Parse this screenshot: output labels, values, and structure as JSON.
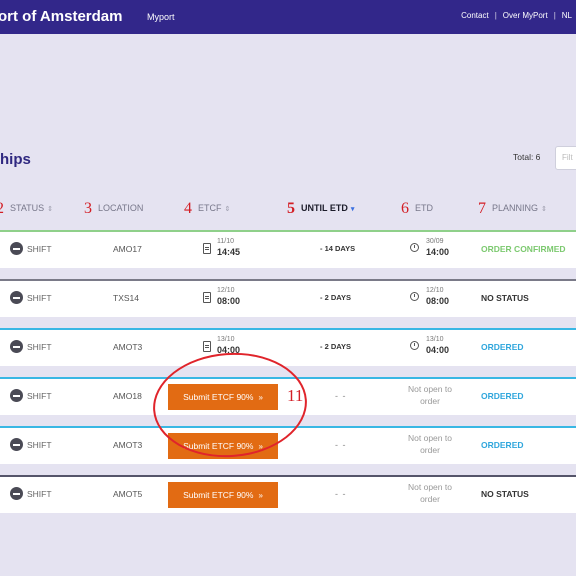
{
  "header": {
    "brand": "ort of Amsterdam",
    "myport": "Myport",
    "nav": [
      "Contact",
      "|",
      "Over MyPort",
      "|",
      "NL"
    ]
  },
  "page": {
    "title": "hips",
    "total_label": "Total: 6",
    "filter_placeholder": "Filt"
  },
  "columns": [
    {
      "num": "2",
      "label": "STATUS",
      "arrow": "⇕"
    },
    {
      "num": "3",
      "label": "LOCATION",
      "arrow": ""
    },
    {
      "num": "4",
      "label": "ETCF",
      "arrow": "⇕"
    },
    {
      "num": "5",
      "label": "UNTIL ETD",
      "arrow": "▾"
    },
    {
      "num": "6",
      "label": "ETD",
      "arrow": ""
    },
    {
      "num": "7",
      "label": "PLANNING",
      "arrow": "⇕"
    }
  ],
  "rows": [
    {
      "status": "SHIFT",
      "location": "AMO17",
      "etcf_date": "11/10",
      "etcf_time": "14:45",
      "until": "- 14 DAYS",
      "etd_date": "30/09",
      "etd_time": "14:00",
      "planning": "ORDER CONFIRMED"
    },
    {
      "status": "SHIFT",
      "location": "TXS14",
      "etcf_date": "12/10",
      "etcf_time": "08:00",
      "until": "- 2 DAYS",
      "etd_date": "12/10",
      "etd_time": "08:00",
      "planning": "NO STATUS"
    },
    {
      "status": "SHIFT",
      "location": "AMOT3",
      "etcf_date": "13/10",
      "etcf_time": "04:00",
      "until": "- 2 DAYS",
      "etd_date": "13/10",
      "etd_time": "04:00",
      "planning": "ORDERED"
    },
    {
      "status": "SHIFT",
      "location": "AMO18",
      "button": "Submit ETCF 90%",
      "until": "- -",
      "etd_note": "Not open to order",
      "planning": "ORDERED"
    },
    {
      "status": "SHIFT",
      "location": "AMOT3",
      "button": "Submit ETCF 90%",
      "until": "- -",
      "etd_note": "Not open to order",
      "planning": "ORDERED"
    },
    {
      "status": "SHIFT",
      "location": "AMOT5",
      "button": "Submit ETCF 90%",
      "until": "- -",
      "etd_note": "Not open to order",
      "planning": "NO STATUS"
    }
  ],
  "annotation": {
    "number": "11"
  },
  "colors": {
    "topbar": "#32278a",
    "button": "#e26b13",
    "planning_green": "#7cc96f",
    "planning_blue": "#2fa6dc",
    "annotation_red": "#d31e25"
  },
  "icons": {
    "status": "minus-circle-icon",
    "etcf": "calendar-icon",
    "etd": "clock-icon",
    "button_chevron": "chevron-right-double-icon"
  }
}
